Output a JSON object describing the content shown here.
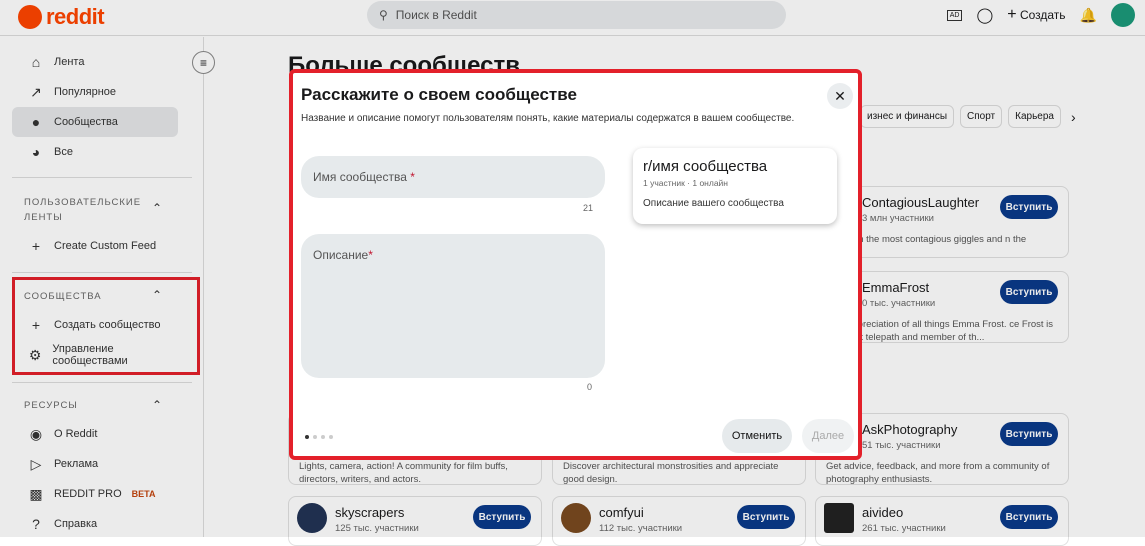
{
  "header": {
    "logo": "reddit",
    "search_placeholder": "Поиск в Reddit",
    "create": "Создать"
  },
  "sidebar": {
    "items": [
      {
        "label": "Лента",
        "icon": "home-icon"
      },
      {
        "label": "Популярное",
        "icon": "popular-icon"
      },
      {
        "label": "Сообщества",
        "icon": "communities-icon"
      },
      {
        "label": "Все",
        "icon": "all-icon"
      }
    ],
    "custom_feeds": {
      "heading": "ПОЛЬЗОВАТЕЛЬСКИЕ ЛЕНТЫ",
      "create": "Create Custom Feed"
    },
    "communities": {
      "heading": "СООБЩЕСТВА",
      "create": "Создать сообщество",
      "manage": "Управление сообществами"
    },
    "resources": {
      "heading": "РЕСУРСЫ",
      "items": [
        "О Reddit",
        "Реклама",
        "REDDIT PRO",
        "Справка"
      ],
      "beta": "BETA"
    }
  },
  "main": {
    "title": "Больше сообществ",
    "chips": [
      "изнес и финансы",
      "Спорт",
      "Карьера"
    ],
    "join_label": "Вступить",
    "cards": [
      {
        "name": "ContagiousLaughter",
        "members": "3 млн участники",
        "desc": "loud with the most contagious giggles and n the internet."
      },
      {
        "name": "EmmaFrost",
        "members": "0 тыс. участники",
        "desc": "it for appreciation of all things Emma Frost. ce Frost is a mutant telepath and member of th..."
      },
      {
        "name": "AskPhotography",
        "members": "51 тыс. участники",
        "desc": "Get advice, feedback, and more from a community of photography enthusiasts."
      },
      {
        "name": "",
        "members": "",
        "desc": "Lights, camera, action! A community for film buffs, directors, writers, and actors."
      },
      {
        "name": "",
        "members": "",
        "desc": "Discover architectural monstrosities and appreciate good design."
      },
      {
        "name": "skyscrapers",
        "members": "125 тыс. участники",
        "desc": ""
      },
      {
        "name": "comfyui",
        "members": "112 тыс. участники",
        "desc": ""
      },
      {
        "name": "aivideo",
        "members": "261 тыс. участники",
        "desc": ""
      }
    ]
  },
  "modal": {
    "title": "Расскажите о своем сообществе",
    "subtitle": "Название и описание помогут пользователям понять, какие материалы содержатся в вашем сообществе.",
    "name_placeholder": "Имя сообщества",
    "name_count": "21",
    "desc_placeholder": "Описание",
    "desc_count": "0",
    "required": "*",
    "preview": {
      "name": "r/имя сообщества",
      "meta": "1 участник  · 1 онлайн",
      "desc": "Описание вашего сообщества"
    },
    "step": 1,
    "total_steps": 4,
    "cancel": "Отменить",
    "next": "Далее"
  }
}
